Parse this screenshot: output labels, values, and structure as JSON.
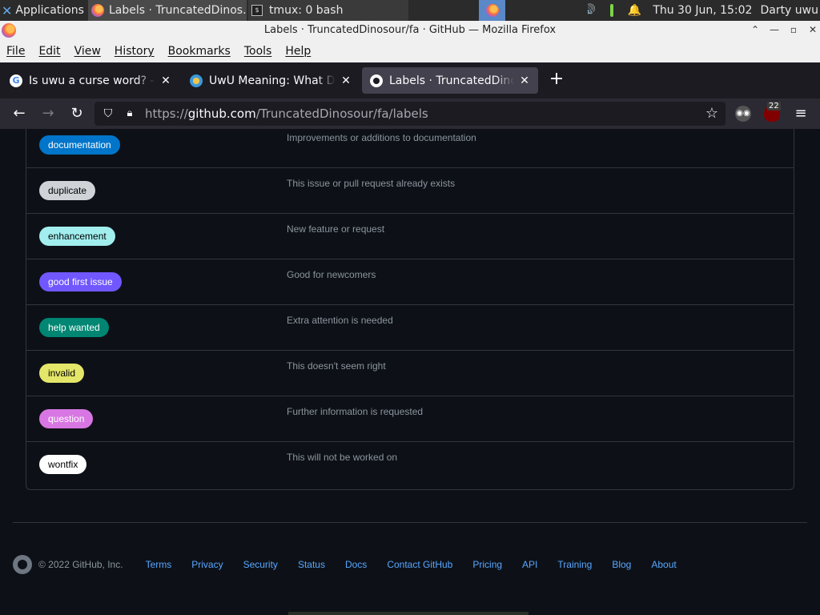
{
  "taskbar": {
    "applications": "Applications",
    "windows": [
      {
        "title": "Labels · TruncatedDinos..."
      },
      {
        "title": "tmux: 0 bash"
      }
    ],
    "clock": "Thu 30 Jun, 15:02",
    "user": "Darty uwu"
  },
  "window": {
    "title": "Labels · TruncatedDinosour/fa · GitHub — Mozilla Firefox"
  },
  "menubar": {
    "items": [
      "File",
      "Edit",
      "View",
      "History",
      "Bookmarks",
      "Tools",
      "Help"
    ]
  },
  "tabs": [
    {
      "title": "Is uwu a curse word? - Google Search",
      "favicon": "google-icon",
      "active": false
    },
    {
      "title": "UwU Meaning: What Does UwU Mean?",
      "favicon": "uwu-site-icon",
      "active": false
    },
    {
      "title": "Labels · TruncatedDinosour/fa",
      "favicon": "github-icon",
      "active": true
    }
  ],
  "navbar": {
    "url_prefix": "https://",
    "url_host": "github.com",
    "url_path": "/TruncatedDinosour/fa/labels",
    "extension_badge": "22"
  },
  "labels": [
    {
      "name": "documentation",
      "description": "Improvements or additions to documentation",
      "bg": "#0075ca",
      "fg": "#ffffff"
    },
    {
      "name": "duplicate",
      "description": "This issue or pull request already exists",
      "bg": "#cfd3d7",
      "fg": "#000000"
    },
    {
      "name": "enhancement",
      "description": "New feature or request",
      "bg": "#a2eeef",
      "fg": "#000000"
    },
    {
      "name": "good first issue",
      "description": "Good for newcomers",
      "bg": "#7057ff",
      "fg": "#ffffff"
    },
    {
      "name": "help wanted",
      "description": "Extra attention is needed",
      "bg": "#008672",
      "fg": "#ffffff"
    },
    {
      "name": "invalid",
      "description": "This doesn't seem right",
      "bg": "#e4e669",
      "fg": "#000000"
    },
    {
      "name": "question",
      "description": "Further information is requested",
      "bg": "#d876e3",
      "fg": "#ffffff"
    },
    {
      "name": "wontfix",
      "description": "This will not be worked on",
      "bg": "#ffffff",
      "fg": "#000000"
    }
  ],
  "footer": {
    "copyright": "© 2022 GitHub, Inc.",
    "links": [
      "Terms",
      "Privacy",
      "Security",
      "Status",
      "Docs",
      "Contact GitHub",
      "Pricing",
      "API",
      "Training",
      "Blog",
      "About"
    ]
  }
}
